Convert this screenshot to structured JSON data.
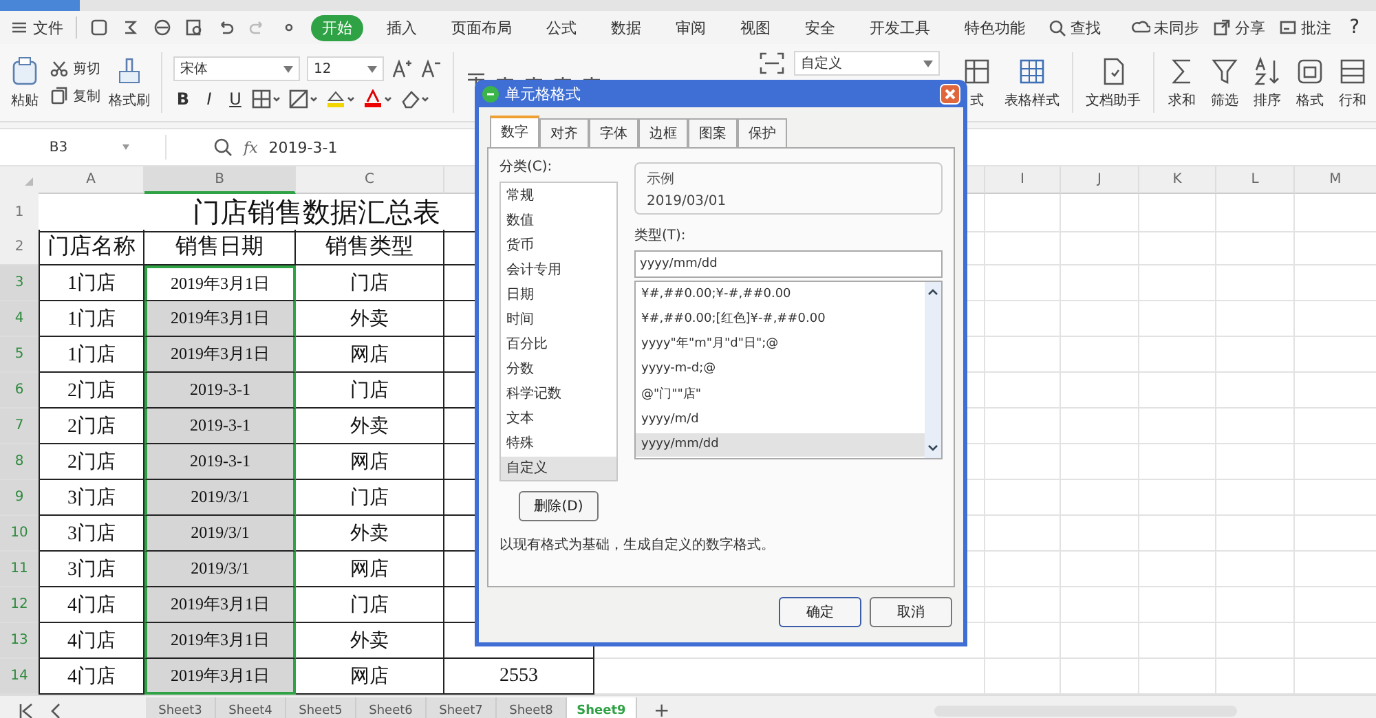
{
  "menu": {
    "file": "文件",
    "tabs": [
      {
        "label": "开始",
        "selected": true
      },
      {
        "label": "插入",
        "selected": false
      },
      {
        "label": "页面布局",
        "selected": false
      },
      {
        "label": "公式",
        "selected": false
      },
      {
        "label": "数据",
        "selected": false
      },
      {
        "label": "审阅",
        "selected": false
      },
      {
        "label": "视图",
        "selected": false
      },
      {
        "label": "安全",
        "selected": false
      },
      {
        "label": "开发工具",
        "selected": false
      },
      {
        "label": "特色功能",
        "selected": false
      }
    ],
    "search": "查找",
    "right": [
      {
        "label": "未同步"
      },
      {
        "label": "分享"
      },
      {
        "label": "批注"
      }
    ],
    "help": "?"
  },
  "ribbon": {
    "paste": "粘贴",
    "cut": "剪切",
    "copy": "复制",
    "format_painter": "格式刷",
    "font_name": "宋体",
    "font_size": "12",
    "font_styles": [
      "B",
      "I",
      "U"
    ],
    "number_format": "自定义",
    "tools": [
      {
        "label": "式"
      },
      {
        "label": "表格样式"
      },
      {
        "label": "文档助手"
      },
      {
        "label": "求和"
      },
      {
        "label": "筛选"
      },
      {
        "label": "排序"
      },
      {
        "label": "格式"
      },
      {
        "label": "行和"
      }
    ]
  },
  "formula_bar": {
    "cell": "B3",
    "fx": "fx",
    "value": "2019-3-1"
  },
  "sheet": {
    "columns": [
      {
        "label": "A",
        "selected": false
      },
      {
        "label": "B",
        "selected": true
      },
      {
        "label": "C",
        "selected": false
      },
      {
        "selected": false
      },
      {
        "selected": false
      },
      {
        "label": "I",
        "selected": false
      },
      {
        "label": "J",
        "selected": false
      },
      {
        "label": "K",
        "selected": false
      },
      {
        "label": "L",
        "selected": false
      },
      {
        "label": "M",
        "selected": false
      }
    ],
    "rows": [
      {
        "number": "1",
        "kind": "title",
        "text": "门店销售数据汇总表",
        "selected": false
      },
      {
        "number": "2",
        "kind": "header",
        "cells": [
          "门店名称",
          "销售日期",
          "销售类型"
        ],
        "selected": false
      },
      {
        "number": "3",
        "kind": "data",
        "cells": [
          "1门店",
          "2019年3月1日",
          "门店"
        ],
        "selected": true,
        "active": true
      },
      {
        "number": "4",
        "kind": "data",
        "cells": [
          "1门店",
          "2019年3月1日",
          "外卖"
        ],
        "selected": true,
        "active": false
      },
      {
        "number": "5",
        "kind": "data",
        "cells": [
          "1门店",
          "2019年3月1日",
          "网店"
        ],
        "selected": true,
        "active": false
      },
      {
        "number": "6",
        "kind": "data",
        "cells": [
          "2门店",
          "2019-3-1",
          "门店"
        ],
        "selected": true,
        "active": false
      },
      {
        "number": "7",
        "kind": "data",
        "cells": [
          "2门店",
          "2019-3-1",
          "外卖"
        ],
        "selected": true,
        "active": false
      },
      {
        "number": "8",
        "kind": "data",
        "cells": [
          "2门店",
          "2019-3-1",
          "网店"
        ],
        "selected": true,
        "active": false
      },
      {
        "number": "9",
        "kind": "data",
        "cells": [
          "3门店",
          "2019/3/1",
          "门店"
        ],
        "selected": true,
        "active": false
      },
      {
        "number": "10",
        "kind": "data",
        "cells": [
          "3门店",
          "2019/3/1",
          "外卖"
        ],
        "selected": true,
        "active": false
      },
      {
        "number": "11",
        "kind": "data",
        "cells": [
          "3门店",
          "2019/3/1",
          "网店"
        ],
        "selected": true,
        "active": false
      },
      {
        "number": "12",
        "kind": "data",
        "cells": [
          "4门店",
          "2019年3月1日",
          "门店"
        ],
        "selected": true,
        "active": false
      },
      {
        "number": "13",
        "kind": "data",
        "cells": [
          "4门店",
          "2019年3月1日",
          "外卖"
        ],
        "selected": true,
        "active": false
      },
      {
        "number": "14",
        "kind": "data",
        "cells": [
          "4门店",
          "2019年3月1日",
          "网店",
          "2553"
        ],
        "selected": true,
        "active": false
      }
    ]
  },
  "sheet_tabs": [
    {
      "label": "Sheet3",
      "selected": false
    },
    {
      "label": "Sheet4",
      "selected": false
    },
    {
      "label": "Sheet5",
      "selected": false
    },
    {
      "label": "Sheet6",
      "selected": false
    },
    {
      "label": "Sheet7",
      "selected": false
    },
    {
      "label": "Sheet8",
      "selected": false
    },
    {
      "label": "Sheet9",
      "selected": true
    }
  ],
  "add_sheet": "+",
  "dialog": {
    "title": "单元格格式",
    "tabs": [
      {
        "label": "数字",
        "selected": true
      },
      {
        "label": "对齐",
        "selected": false
      },
      {
        "label": "字体",
        "selected": false
      },
      {
        "label": "边框",
        "selected": false
      },
      {
        "label": "图案",
        "selected": false
      },
      {
        "label": "保护",
        "selected": false
      }
    ],
    "category_label": "分类(C):",
    "categories": [
      {
        "label": "常规",
        "selected": false
      },
      {
        "label": "数值",
        "selected": false
      },
      {
        "label": "货币",
        "selected": false
      },
      {
        "label": "会计专用",
        "selected": false
      },
      {
        "label": "日期",
        "selected": false
      },
      {
        "label": "时间",
        "selected": false
      },
      {
        "label": "百分比",
        "selected": false
      },
      {
        "label": "分数",
        "selected": false
      },
      {
        "label": "科学记数",
        "selected": false
      },
      {
        "label": "文本",
        "selected": false
      },
      {
        "label": "特殊",
        "selected": false
      },
      {
        "label": "自定义",
        "selected": true
      }
    ],
    "sample_label": "示例",
    "sample": "2019/03/01",
    "type_label": "类型(T):",
    "type_value": "yyyy/mm/dd",
    "types": [
      {
        "label": "¥#,##0.00;¥-#,##0.00",
        "selected": false
      },
      {
        "label": "¥#,##0.00;[红色]¥-#,##0.00",
        "selected": false
      },
      {
        "label": "yyyy\"年\"m\"月\"d\"日\";@",
        "selected": false
      },
      {
        "label": "yyyy-m-d;@",
        "selected": false
      },
      {
        "label": "@\"门\"\"店\"",
        "selected": false
      },
      {
        "label": "yyyy/m/d",
        "selected": false
      },
      {
        "label": "yyyy/mm/dd",
        "selected": true
      }
    ],
    "delete": "删除(D)",
    "description": "以现有格式为基础，生成自定义的数字格式。",
    "ok": "确定",
    "cancel": "取消"
  }
}
